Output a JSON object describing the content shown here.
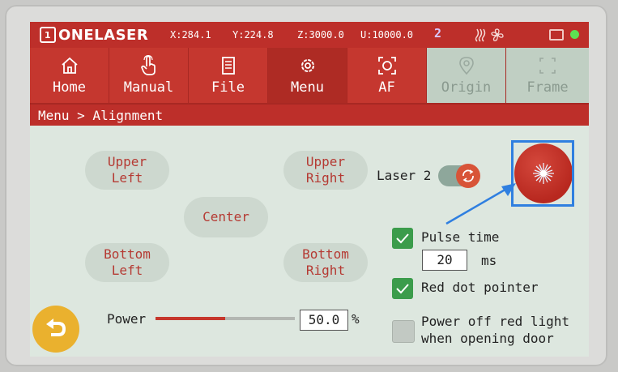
{
  "status": {
    "logo_mark": "1",
    "brand": "ONELASER",
    "x": "X:284.1",
    "y": "Y:224.8",
    "z": "Z:3000.0",
    "u": "U:10000.0",
    "laser_number": "2"
  },
  "nav": {
    "tabs": [
      {
        "label": "Home",
        "icon": "home-icon",
        "state": "normal"
      },
      {
        "label": "Manual",
        "icon": "hand-pointer-icon",
        "state": "normal"
      },
      {
        "label": "File",
        "icon": "document-icon",
        "state": "normal"
      },
      {
        "label": "Menu",
        "icon": "gear-icon",
        "state": "active"
      },
      {
        "label": "AF",
        "icon": "autofocus-icon",
        "state": "normal"
      },
      {
        "label": "Origin",
        "icon": "location-pin-icon",
        "state": "disabled"
      },
      {
        "label": "Frame",
        "icon": "frame-icon",
        "state": "disabled"
      }
    ]
  },
  "breadcrumb": "Menu > Alignment",
  "alignment": {
    "upper_left": "Upper\nLeft",
    "upper_right": "Upper\nRight",
    "center": "Center",
    "bottom_left": "Bottom\nLeft",
    "bottom_right": "Bottom\nRight"
  },
  "laser_select": {
    "label": "Laser 2",
    "on": true
  },
  "pulse_time": {
    "label": "Pulse time",
    "checked": true,
    "value": "20",
    "unit": "ms"
  },
  "red_dot": {
    "label": "Red dot pointer",
    "checked": true
  },
  "power_off_red": {
    "label": "Power off red light\nwhen opening door",
    "checked": false
  },
  "power": {
    "label": "Power",
    "value": "50.0",
    "unit": "%",
    "level": 0.5
  },
  "colors": {
    "brand_red": "#bd2f2a",
    "active_tab": "#ae2b24",
    "check_green": "#3b9c4b",
    "highlight_blue": "#2f7fe0",
    "back_yellow": "#eab12e"
  }
}
